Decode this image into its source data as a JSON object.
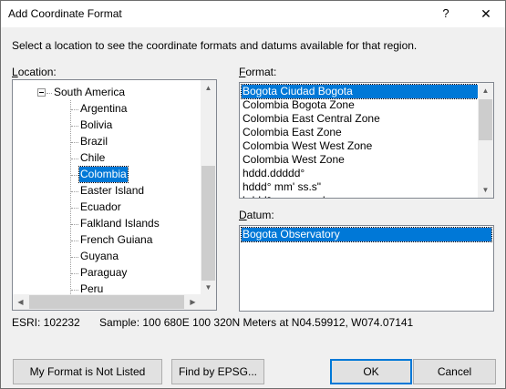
{
  "window": {
    "title": "Add Coordinate Format",
    "help_label": "?",
    "close_label": "✕"
  },
  "instruction": "Select a location to see the coordinate formats and datums available for that region.",
  "location": {
    "label_underlined": "L",
    "label_rest": "ocation:",
    "parent": "South America",
    "items": [
      "Argentina",
      "Bolivia",
      "Brazil",
      "Chile",
      "Colombia",
      "Easter Island",
      "Ecuador",
      "Falkland Islands",
      "French Guiana",
      "Guyana",
      "Paraguay",
      "Peru"
    ],
    "selected": "Colombia"
  },
  "format": {
    "label_underlined": "F",
    "label_rest": "ormat:",
    "items": [
      "Bogota Ciudad Bogota",
      "Colombia Bogota Zone",
      "Colombia East Central Zone",
      "Colombia East Zone",
      "Colombia West West Zone",
      "Colombia West Zone",
      "hddd.ddddd°",
      "hddd° mm' ss.s\"",
      "hddd° mm.mmm'"
    ],
    "selected": "Bogota Ciudad Bogota"
  },
  "datum": {
    "label_underlined": "D",
    "label_rest": "atum:",
    "items": [
      "Bogota Observatory"
    ],
    "selected": "Bogota Observatory"
  },
  "esri": "ESRI: 102232",
  "sample": "Sample: 100 680E  100 320N Meters at N04.59912, W074.07141",
  "buttons": {
    "not_listed": "My Format is Not Listed",
    "find_epsg": "Find by EPSG...",
    "ok": "OK",
    "cancel": "Cancel"
  },
  "icons": {
    "scroll_up": "▲",
    "scroll_down": "▼",
    "scroll_left": "◀",
    "scroll_right": "▶"
  }
}
